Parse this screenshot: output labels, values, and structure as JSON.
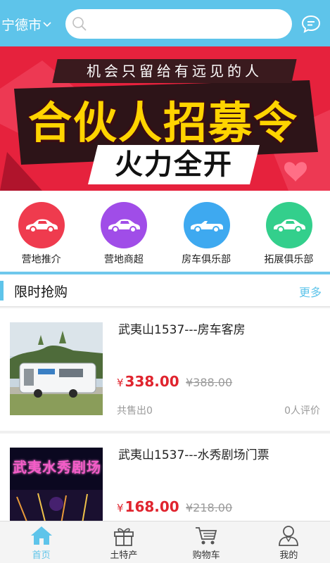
{
  "header": {
    "city": "宁德市",
    "search_placeholder": "",
    "colors": {
      "header_bg": "#5ec4ea"
    },
    "icons": {
      "city": "chevron-down-icon",
      "search": "search-icon",
      "message": "chat-bubble-icon"
    }
  },
  "banner": {
    "tagline": "机会只留给有远见的人",
    "headline": "合伙人招募令",
    "subline": "火力全开",
    "carousel": {
      "pages": 3,
      "active": 2
    }
  },
  "categories": [
    {
      "label": "营地推介",
      "color": "#ef3b4e",
      "icon": "car-icon"
    },
    {
      "label": "营地商超",
      "color": "#a04de8",
      "icon": "car-icon"
    },
    {
      "label": "房车俱乐部",
      "color": "#3ea9f0",
      "icon": "convertible-car-icon"
    },
    {
      "label": "拓展俱乐部",
      "color": "#33cf8c",
      "icon": "car-icon"
    }
  ],
  "flash_sale": {
    "title": "限时抢购",
    "more": "更多"
  },
  "products": [
    {
      "name": "武夷山1537---房车客房",
      "currency": "¥",
      "price": "338.00",
      "old_price": "¥388.00",
      "sold": "共售出0",
      "reviews": "0人评价"
    },
    {
      "name": "武夷山1537---水秀剧场门票",
      "currency": "¥",
      "price": "168.00",
      "old_price": "¥218.00",
      "thumb_text": "武夷水秀剧场"
    }
  ],
  "tabbar": [
    {
      "label": "首页",
      "icon": "home-icon",
      "active": true
    },
    {
      "label": "土特产",
      "icon": "gift-icon",
      "active": false
    },
    {
      "label": "购物车",
      "icon": "cart-icon",
      "active": false
    },
    {
      "label": "我的",
      "icon": "user-icon",
      "active": false
    }
  ]
}
